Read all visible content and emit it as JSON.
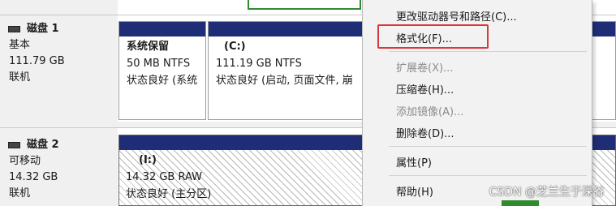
{
  "disks": [
    {
      "name": "磁盘 1",
      "type": "基本",
      "size": "111.79 GB",
      "status": "联机",
      "partitions": [
        {
          "label": "系统保留",
          "size_fs": "50 MB NTFS",
          "health": "状态良好 (系统"
        },
        {
          "label": "(C:)",
          "size_fs": "111.19 GB NTFS",
          "health": "状态良好 (启动, 页面文件, 崩"
        }
      ]
    },
    {
      "name": "磁盘 2",
      "type": "可移动",
      "size": "14.32 GB",
      "status": "联机",
      "partitions": [
        {
          "label": "(I:)",
          "size_fs": "14.32 GB RAW",
          "health": "状态良好 (主分区)"
        }
      ]
    }
  ],
  "context_menu": {
    "items": [
      {
        "label": "更改驱动器号和路径(C)...",
        "enabled": true
      },
      {
        "label": "格式化(F)...",
        "enabled": true,
        "highlighted": true
      },
      {
        "label": "扩展卷(X)...",
        "enabled": false
      },
      {
        "label": "压缩卷(H)...",
        "enabled": true
      },
      {
        "label": "添加镜像(A)...",
        "enabled": false
      },
      {
        "label": "删除卷(D)...",
        "enabled": true
      },
      {
        "label": "属性(P)",
        "enabled": true
      },
      {
        "label": "帮助(H)",
        "enabled": true
      }
    ]
  },
  "watermark": "CSDN @芝兰生于深谷",
  "colors": {
    "partition_bar": "#1f2d76",
    "highlight_box": "#d8383d",
    "selected_border": "#2e8b2e"
  }
}
